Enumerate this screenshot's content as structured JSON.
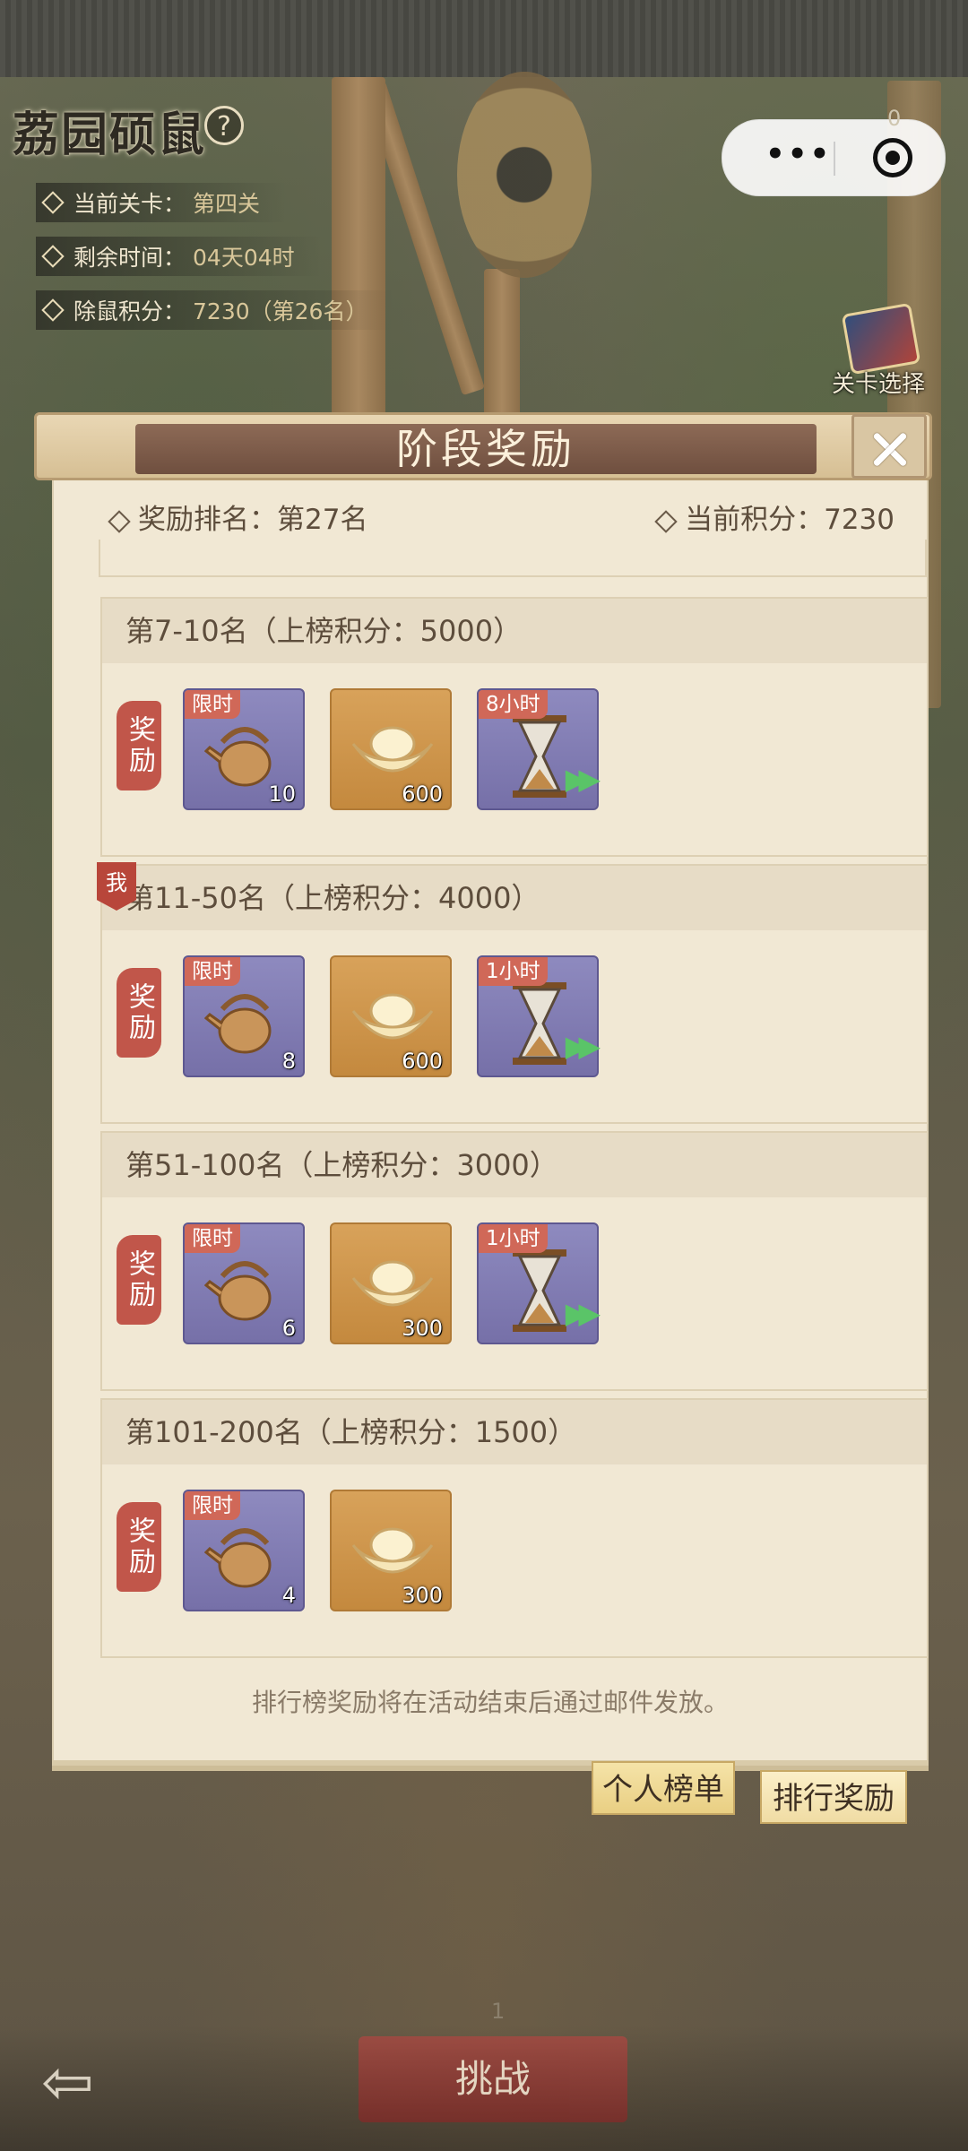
{
  "event": {
    "title": "荔园硕鼠",
    "info": [
      {
        "label": "当前关卡：",
        "value": "第四关"
      },
      {
        "label": "剩余时间：",
        "value": "04天04时"
      },
      {
        "label": "除鼠积分：",
        "value": "7230（第26名）"
      }
    ],
    "level_select": "关卡选择",
    "counter": "0"
  },
  "panel": {
    "title": "阶段奖励",
    "reward_rank": "奖励排名：第27名",
    "current_score": "当前积分：7230",
    "reward_label": "奖励",
    "me_badge": "我",
    "tiers": [
      {
        "header": "第7-10名（上榜积分：5000）",
        "items": [
          {
            "type": "kettle",
            "tag": "限时",
            "count": "10"
          },
          {
            "type": "ingot",
            "tag": "",
            "count": "600"
          },
          {
            "type": "hourglass",
            "tag": "8小时",
            "count": ""
          }
        ]
      },
      {
        "header": "第11-50名（上榜积分：4000）",
        "items": [
          {
            "type": "kettle",
            "tag": "限时",
            "count": "8"
          },
          {
            "type": "ingot",
            "tag": "",
            "count": "600"
          },
          {
            "type": "hourglass",
            "tag": "1小时",
            "count": ""
          }
        ]
      },
      {
        "header": "第51-100名（上榜积分：3000）",
        "items": [
          {
            "type": "kettle",
            "tag": "限时",
            "count": "6"
          },
          {
            "type": "ingot",
            "tag": "",
            "count": "300"
          },
          {
            "type": "hourglass",
            "tag": "1小时",
            "count": ""
          }
        ]
      },
      {
        "header": "第101-200名（上榜积分：1500）",
        "items": [
          {
            "type": "kettle",
            "tag": "限时",
            "count": "4"
          },
          {
            "type": "ingot",
            "tag": "",
            "count": "300"
          }
        ]
      }
    ],
    "footer_note": "排行榜奖励将在活动结束后通过邮件发放。",
    "tabs": {
      "personal": "个人榜单",
      "rewards": "排行奖励"
    }
  },
  "bottom": {
    "page": "1",
    "challenge": "挑战"
  }
}
